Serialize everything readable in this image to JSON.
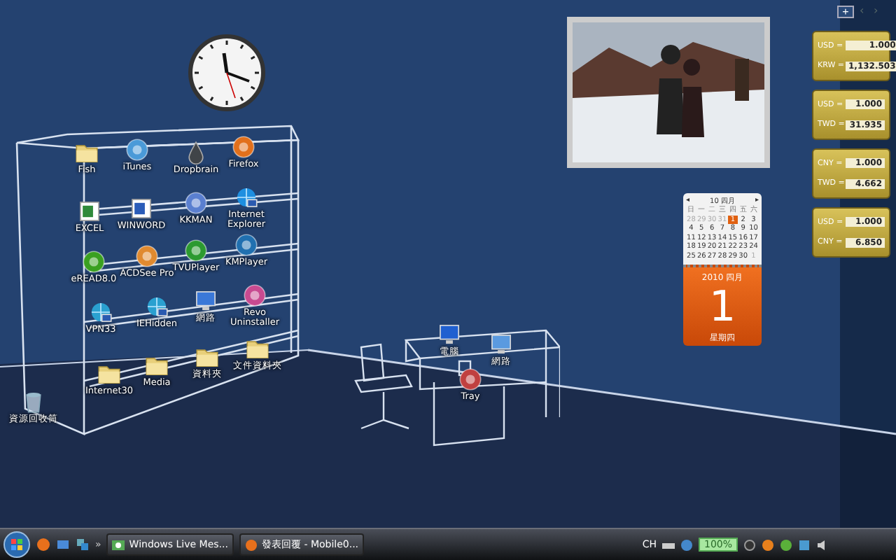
{
  "desktop_icons": [
    {
      "label": "Fish",
      "kind": "folder"
    },
    {
      "label": "iTunes",
      "kind": "app",
      "color": "#4a9ad8"
    },
    {
      "label": "Dropbrain",
      "kind": "drop",
      "color": "#404448"
    },
    {
      "label": "Firefox",
      "kind": "app",
      "color": "#e2701c"
    },
    {
      "label": "EXCEL",
      "kind": "doc",
      "color": "#2f8a3a"
    },
    {
      "label": "WINWORD",
      "kind": "doc",
      "color": "#2b5cb8"
    },
    {
      "label": "KKMAN",
      "kind": "app",
      "color": "#5a7fd0"
    },
    {
      "label": "Internet Explorer",
      "kind": "globe",
      "color": "#1e8fe0"
    },
    {
      "label": "eREAD8.0",
      "kind": "app",
      "color": "#3aa020"
    },
    {
      "label": "ACDSee Pro",
      "kind": "app",
      "color": "#e08a30"
    },
    {
      "label": "TVUPlayer",
      "kind": "app",
      "color": "#2c9a30"
    },
    {
      "label": "KMPlayer",
      "kind": "app",
      "color": "#2070b0"
    },
    {
      "label": "VPN33",
      "kind": "globe",
      "color": "#2aa0d0"
    },
    {
      "label": "IEHidden",
      "kind": "globe",
      "color": "#2aa0d0"
    },
    {
      "label": "網路",
      "kind": "computer",
      "color": "#3a78d8"
    },
    {
      "label": "Revo Uninstaller",
      "kind": "app",
      "color": "#c84a90"
    },
    {
      "label": "Internet30",
      "kind": "folder"
    },
    {
      "label": "Media",
      "kind": "folder"
    },
    {
      "label": "資料夾",
      "kind": "folder"
    },
    {
      "label": "文件資料夾",
      "kind": "folder"
    },
    {
      "label": "資源回收筒",
      "kind": "trash"
    },
    {
      "label": "電腦",
      "kind": "computer",
      "color": "#2060d0"
    },
    {
      "label": "網路",
      "kind": "computer",
      "color": "#5a9ae0"
    },
    {
      "label": "Tray",
      "kind": "app",
      "color": "#c04040"
    }
  ],
  "currency_gadgets": [
    {
      "from_code": "USD =",
      "from_value": "1.000",
      "to_code": "KRW =",
      "to_value": "1,132.503"
    },
    {
      "from_code": "USD =",
      "from_value": "1.000",
      "to_code": "TWD =",
      "to_value": "31.935"
    },
    {
      "from_code": "CNY =",
      "from_value": "1.000",
      "to_code": "TWD =",
      "to_value": "4.662"
    },
    {
      "from_code": "USD =",
      "from_value": "1.000",
      "to_code": "CNY =",
      "to_value": "6.850"
    }
  ],
  "gadget_toolbar": {
    "add": "+",
    "prev": "‹",
    "next": "›"
  },
  "calendar": {
    "prev": "◂",
    "month": "10 四月",
    "next": "▸",
    "weekdays": [
      "日",
      "一",
      "二",
      "三",
      "四",
      "五",
      "六"
    ],
    "days": [
      {
        "day": "28",
        "other": true,
        "selected": false
      },
      {
        "day": "29",
        "other": true,
        "selected": false
      },
      {
        "day": "30",
        "other": true,
        "selected": false
      },
      {
        "day": "31",
        "other": true,
        "selected": false
      },
      {
        "day": "1",
        "other": false,
        "selected": true
      },
      {
        "day": "2",
        "other": false,
        "selected": false
      },
      {
        "day": "3",
        "other": false,
        "selected": false
      },
      {
        "day": "4",
        "other": false,
        "selected": false
      },
      {
        "day": "5",
        "other": false,
        "selected": false
      },
      {
        "day": "6",
        "other": false,
        "selected": false
      },
      {
        "day": "7",
        "other": false,
        "selected": false
      },
      {
        "day": "8",
        "other": false,
        "selected": false
      },
      {
        "day": "9",
        "other": false,
        "selected": false
      },
      {
        "day": "10",
        "other": false,
        "selected": false
      },
      {
        "day": "11",
        "other": false,
        "selected": false
      },
      {
        "day": "12",
        "other": false,
        "selected": false
      },
      {
        "day": "13",
        "other": false,
        "selected": false
      },
      {
        "day": "14",
        "other": false,
        "selected": false
      },
      {
        "day": "15",
        "other": false,
        "selected": false
      },
      {
        "day": "16",
        "other": false,
        "selected": false
      },
      {
        "day": "17",
        "other": false,
        "selected": false
      },
      {
        "day": "18",
        "other": false,
        "selected": false
      },
      {
        "day": "19",
        "other": false,
        "selected": false
      },
      {
        "day": "20",
        "other": false,
        "selected": false
      },
      {
        "day": "21",
        "other": false,
        "selected": false
      },
      {
        "day": "22",
        "other": false,
        "selected": false
      },
      {
        "day": "23",
        "other": false,
        "selected": false
      },
      {
        "day": "24",
        "other": false,
        "selected": false
      },
      {
        "day": "25",
        "other": false,
        "selected": false
      },
      {
        "day": "26",
        "other": false,
        "selected": false
      },
      {
        "day": "27",
        "other": false,
        "selected": false
      },
      {
        "day": "28",
        "other": false,
        "selected": false
      },
      {
        "day": "29",
        "other": false,
        "selected": false
      },
      {
        "day": "30",
        "other": false,
        "selected": false
      },
      {
        "day": "1",
        "other": true,
        "selected": false
      }
    ],
    "year_month": "2010 四月",
    "big_day": "1",
    "weekday": "星期四"
  },
  "taskbar": {
    "quick_launch_more": "»",
    "tasks": [
      {
        "label": "Windows Live Mes...",
        "kind": "messenger"
      },
      {
        "label": "發表回覆 - Mobile0...",
        "kind": "browser"
      }
    ],
    "language": "CH",
    "zoom": "100%"
  }
}
